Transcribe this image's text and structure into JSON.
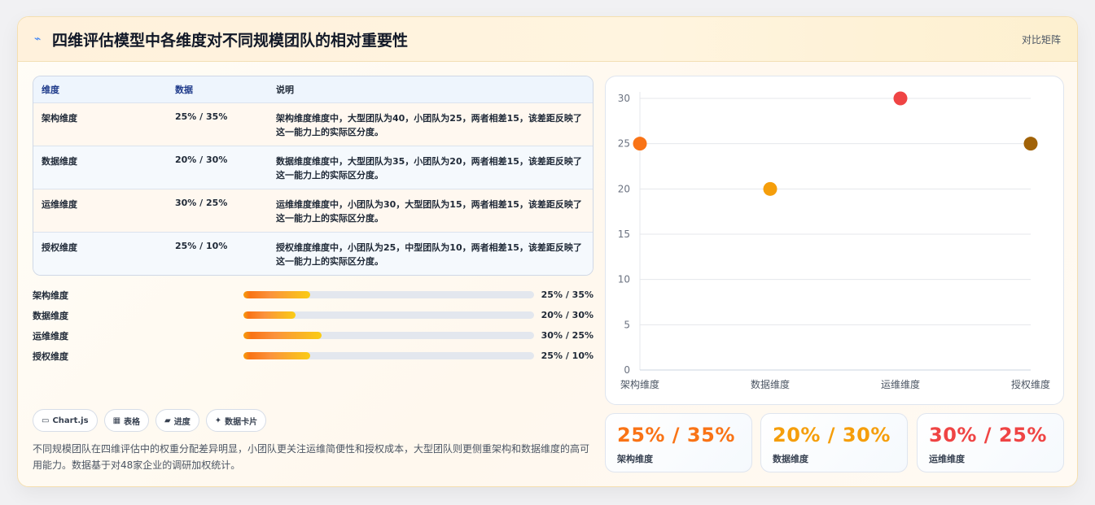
{
  "header": {
    "title": "四维评估模型中各维度对不同规模团队的相对重要性",
    "tag": "对比矩阵"
  },
  "table": {
    "columns": [
      "维度",
      "数据",
      "说明"
    ],
    "rows": [
      {
        "dim": "架构维度",
        "data": "25% / 35%",
        "desc": "架构维度维度中，大型团队为40，小团队为25，两者相差15，该差距反映了这一能力上的实际区分度。"
      },
      {
        "dim": "数据维度",
        "data": "20% / 30%",
        "desc": "数据维度维度中，大型团队为35，小团队为20，两者相差15，该差距反映了这一能力上的实际区分度。"
      },
      {
        "dim": "运维维度",
        "data": "30% / 25%",
        "desc": "运维维度维度中，小团队为30，大型团队为15，两者相差15，该差距反映了这一能力上的实际区分度。"
      },
      {
        "dim": "授权维度",
        "data": "25% / 10%",
        "desc": "授权维度维度中，小团队为25，中型团队为10，两者相差15，该差距反映了这一能力上的实际区分度。"
      }
    ]
  },
  "progress": [
    {
      "label": "架构维度",
      "value": "25% / 35%",
      "fraction": 0.23
    },
    {
      "label": "数据维度",
      "value": "20% / 30%",
      "fraction": 0.18
    },
    {
      "label": "运维维度",
      "value": "30% / 25%",
      "fraction": 0.27
    },
    {
      "label": "授权维度",
      "value": "25% / 10%",
      "fraction": 0.23
    }
  ],
  "chips": [
    {
      "icon": "▭",
      "label": "Chart.js"
    },
    {
      "icon": "▦",
      "label": "表格"
    },
    {
      "icon": "▰",
      "label": "进度"
    },
    {
      "icon": "✦",
      "label": "数据卡片"
    }
  ],
  "note": "不同规模团队在四维评估中的权重分配差异明显，小团队更关注运维简便性和授权成本，大型团队则更侧重架构和数据维度的高可用能力。数据基于对48家企业的调研加权统计。",
  "stats": [
    {
      "value": "25% / 35%",
      "label": "架构维度",
      "color": "#f97316"
    },
    {
      "value": "20% / 30%",
      "label": "数据维度",
      "color": "#f59e0b"
    },
    {
      "value": "30% / 25%",
      "label": "运维维度",
      "color": "#ef4444"
    }
  ],
  "chart_data": {
    "type": "scatter",
    "categories": [
      "架构维度",
      "数据维度",
      "运维维度",
      "授权维度"
    ],
    "values": [
      25,
      20,
      30,
      25
    ],
    "colors": [
      "#f97316",
      "#f59e0b",
      "#ef4444",
      "#a16207"
    ],
    "ylim": [
      0,
      30
    ],
    "yticks": [
      0,
      5,
      10,
      15,
      20,
      25,
      30
    ],
    "grid": true
  }
}
